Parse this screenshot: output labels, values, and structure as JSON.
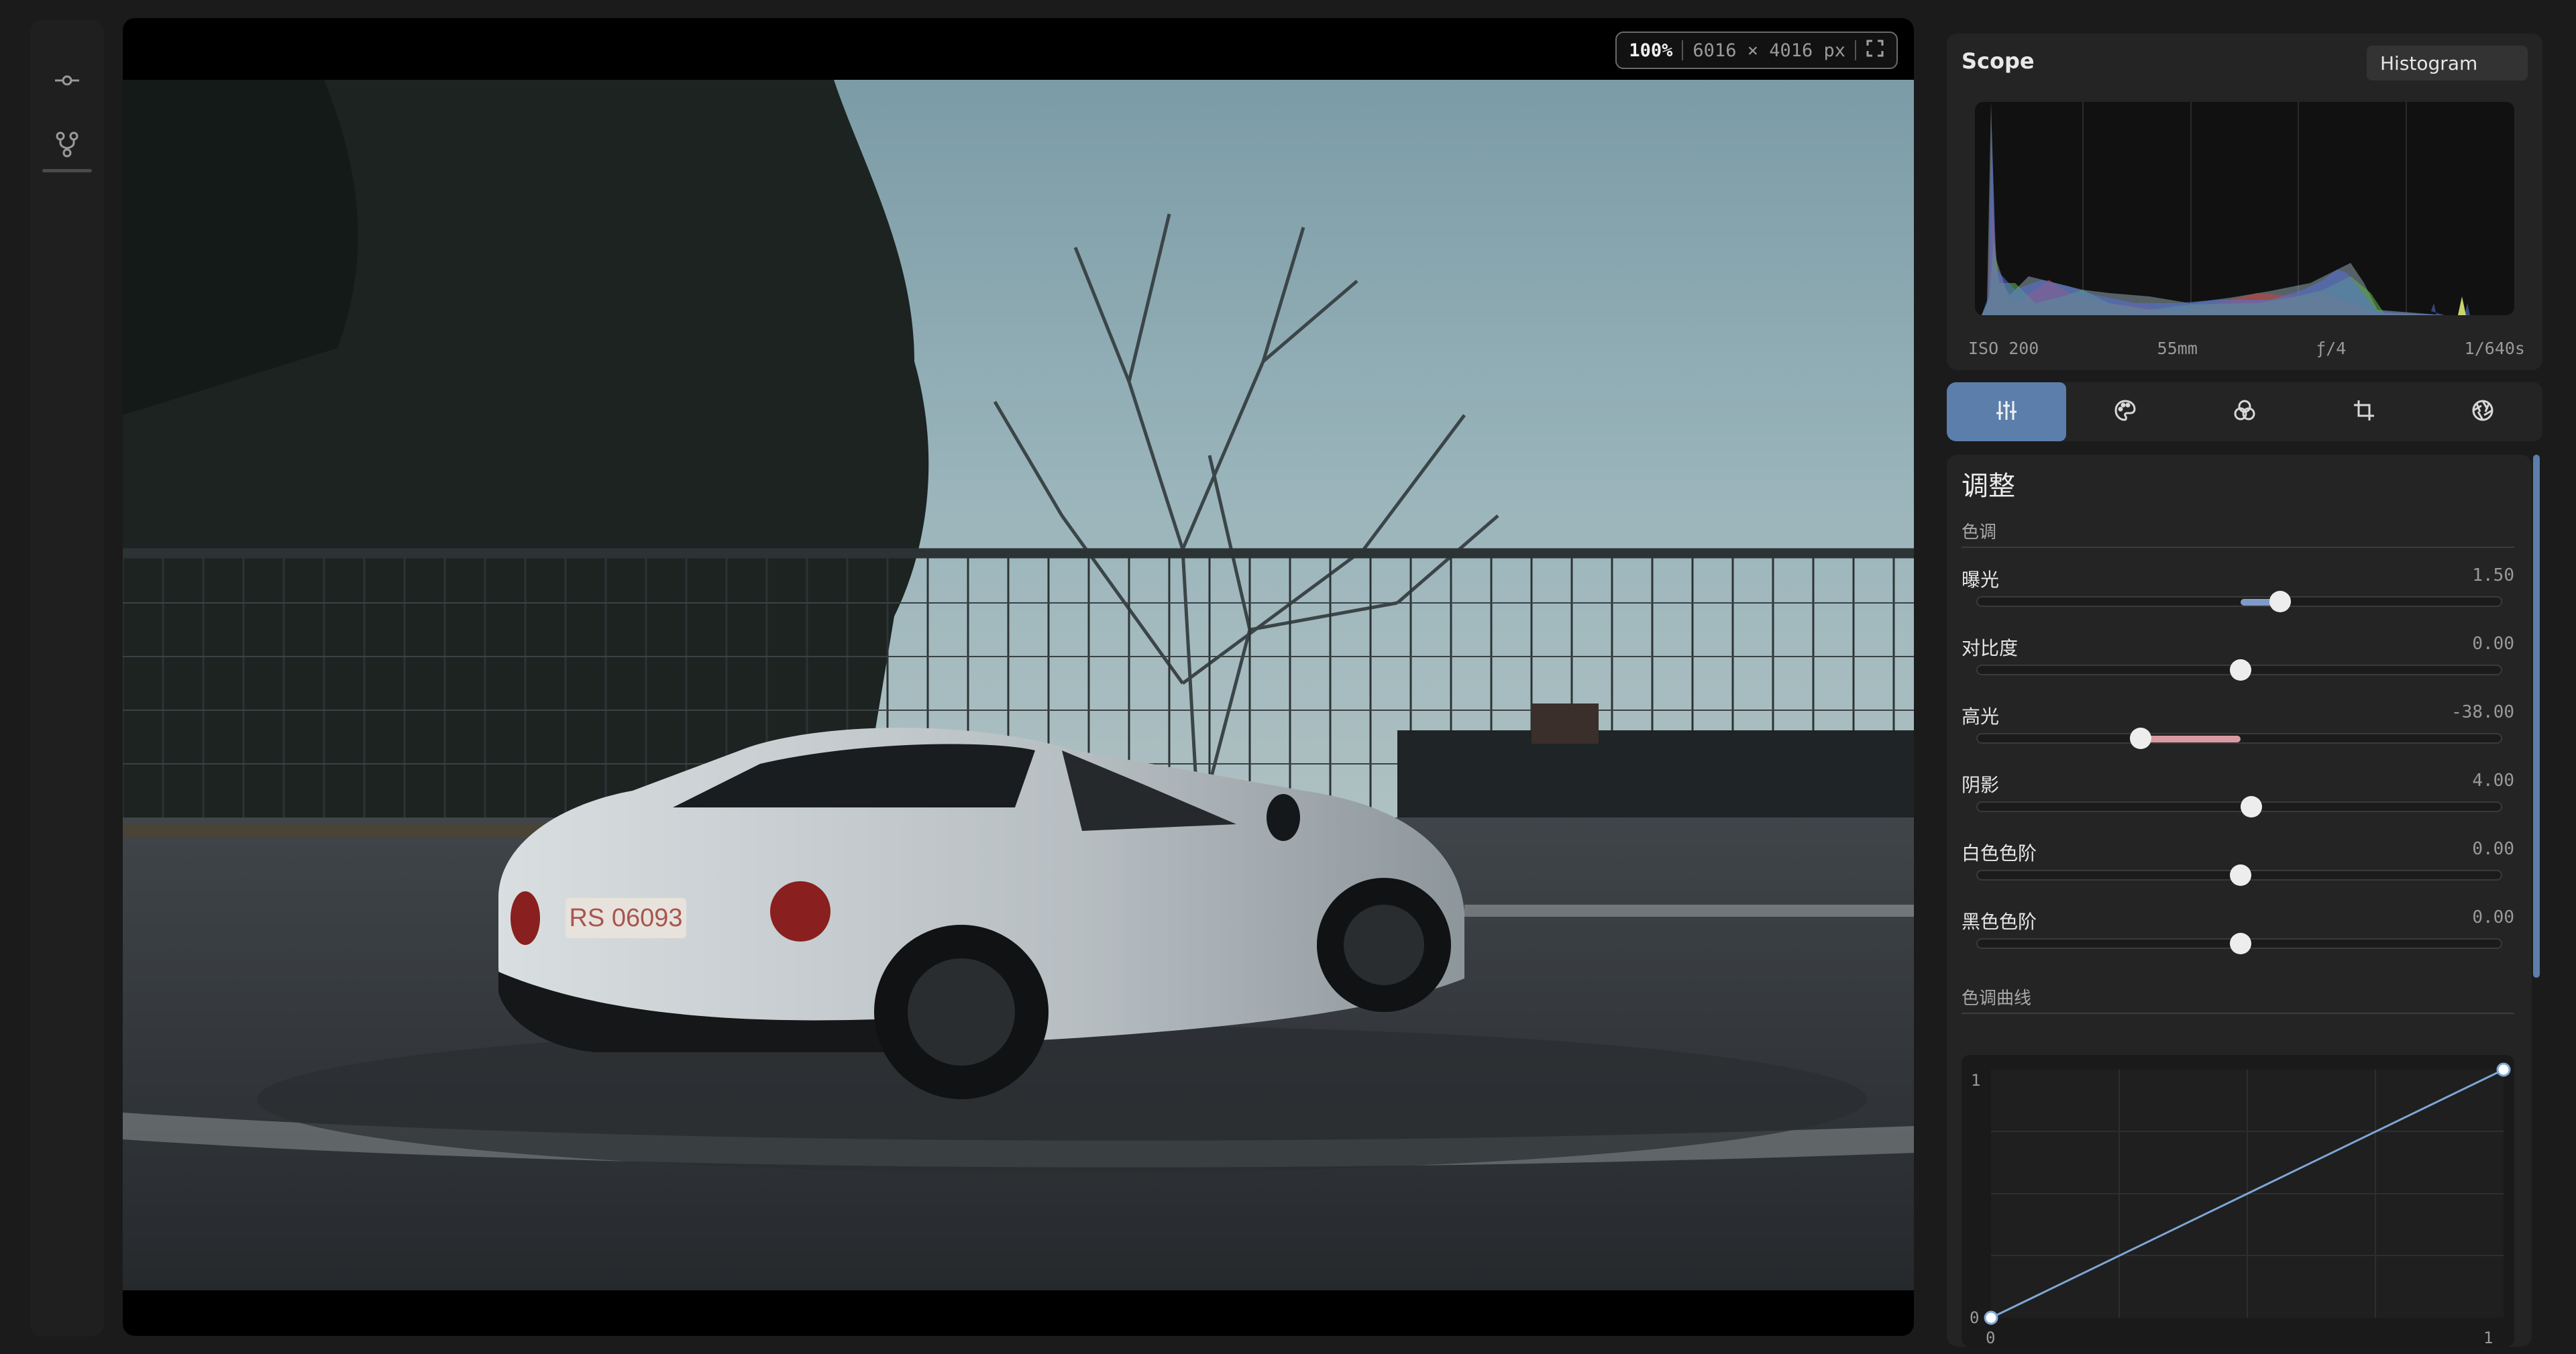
{
  "rail": {
    "icons": [
      "commit-icon",
      "branch-icon"
    ]
  },
  "viewer": {
    "zoom": "100%",
    "dimensions": "6016 × 4016 px",
    "license_plate": "RS 06093"
  },
  "scope": {
    "title": "Scope",
    "mode": "Histogram",
    "exif": {
      "iso": "ISO 200",
      "focal": "55mm",
      "aperture": "ƒ/4",
      "shutter": "1/640s"
    },
    "histogram_colors": {
      "red": "#c0453f",
      "green": "#5fae4f",
      "blue": "#5572d8",
      "luma": "#9fb4bf"
    }
  },
  "tabs": [
    {
      "name": "adjust",
      "icon": "sliders-icon",
      "active": true
    },
    {
      "name": "color",
      "icon": "palette-icon",
      "active": false
    },
    {
      "name": "mix",
      "icon": "color-circles-icon",
      "active": false
    },
    {
      "name": "crop",
      "icon": "crop-icon",
      "active": false
    },
    {
      "name": "lens",
      "icon": "aperture-icon",
      "active": false
    }
  ],
  "adjust": {
    "title": "调整",
    "tone_section": "色调",
    "curve_section": "色调曲线",
    "sliders": [
      {
        "name": "曝光",
        "value": "1.50",
        "fraction": 0.575,
        "fill_color": "#7f9bc8"
      },
      {
        "name": "对比度",
        "value": "0.00",
        "fraction": 0.5,
        "fill_color": ""
      },
      {
        "name": "高光",
        "value": "-38.00",
        "fraction": 0.31,
        "fill_color": "#d99aa2"
      },
      {
        "name": "阴影",
        "value": "4.00",
        "fraction": 0.52,
        "fill_color": ""
      },
      {
        "name": "白色色阶",
        "value": "0.00",
        "fraction": 0.5,
        "fill_color": ""
      },
      {
        "name": "黑色色阶",
        "value": "0.00",
        "fraction": 0.5,
        "fill_color": ""
      }
    ],
    "curve": {
      "y_max_label": "1",
      "y_min_label": "0",
      "x_min_label": "0",
      "x_max_label": "1",
      "line_color": "#7fa7d6"
    }
  },
  "accent": "#5b7eab"
}
